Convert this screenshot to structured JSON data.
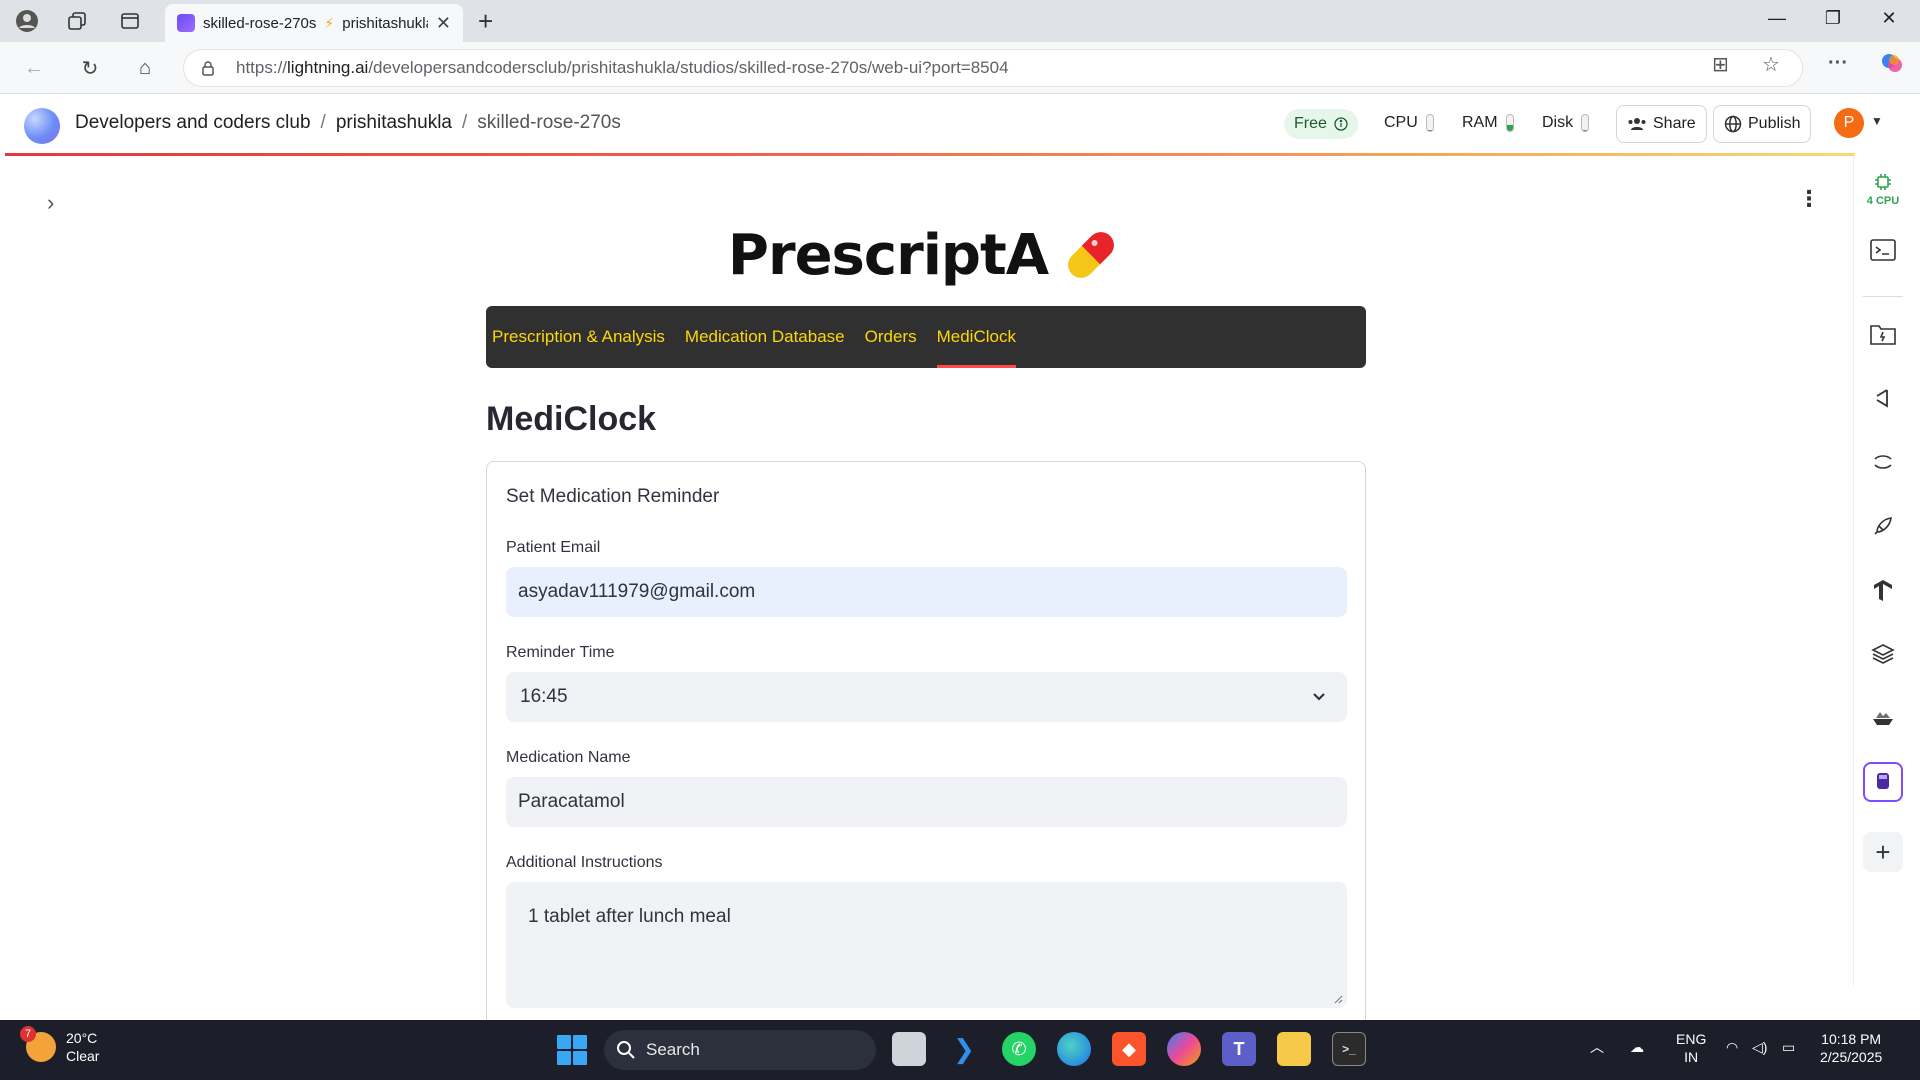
{
  "browser": {
    "tab_title": "skilled-rose-270s",
    "tab_title_suffix": "prishitashukla",
    "url_prefix": "https://",
    "url_host": "lightning.ai",
    "url_path": "/developersandcodersclub/prishitashukla/studios/skilled-rose-270s/web-ui?port=8504"
  },
  "studio": {
    "crumbs": [
      "Developers and coders club",
      "prishitashukla",
      "skilled-rose-270s"
    ],
    "plan_badge": "Free",
    "resources": [
      {
        "label": "CPU",
        "level": 0.05
      },
      {
        "label": "RAM",
        "level": 0.35
      },
      {
        "label": "Disk",
        "level": 0.05
      }
    ],
    "share_label": "Share",
    "publish_label": "Publish",
    "avatar_letter": "P",
    "rail_cpu_label": "4 CPU"
  },
  "app": {
    "logo_text": "PrescriptA",
    "nav": [
      "Prescription & Analysis",
      "Medication Database",
      "Orders",
      "MediClock"
    ],
    "active_nav": "MediClock",
    "page_title": "MediClock",
    "form": {
      "heading": "Set Medication Reminder",
      "email_label": "Patient Email",
      "email_value": "asyadav111979@gmail.com",
      "time_label": "Reminder Time",
      "time_value": "16:45",
      "med_label": "Medication Name",
      "med_value": "Paracatamol",
      "instr_label": "Additional Instructions",
      "instr_value": "1 tablet after lunch meal"
    }
  },
  "taskbar": {
    "weather_badge": "7",
    "temperature": "20°C",
    "condition": "Clear",
    "search_label": "Search",
    "lang_line1": "ENG",
    "lang_line2": "IN",
    "time": "10:18 PM",
    "date": "2/25/2025"
  }
}
